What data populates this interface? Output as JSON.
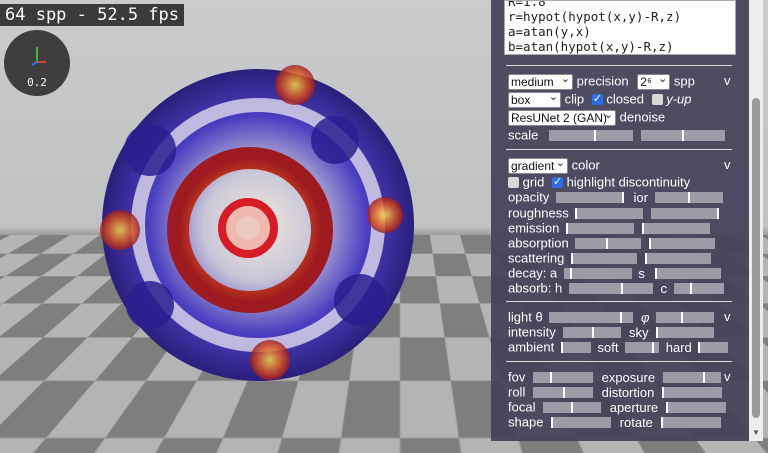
{
  "hud": {
    "fps_text": "64 spp - 52.5 fps",
    "gizmo_value": "0.2"
  },
  "code_lines": [
    "R=1.8",
    "r=hypot(hypot(x,y)-R,z)",
    "a=atan(y,x)",
    "b=atan(hypot(x,y)-R,z)"
  ],
  "render": {
    "precision_value": "medium",
    "precision_label": "precision",
    "spp_value": "2⁶",
    "spp_label": "spp",
    "collapse_label": "v",
    "clip_value": "box",
    "clip_label": "clip",
    "closed_label": "closed",
    "closed_checked": true,
    "yup_label": "y-up",
    "yup_checked": false,
    "denoise_value": "ResUNet 2 (GAN)",
    "denoise_label": "denoise",
    "scale_label": "scale",
    "scale_levels": [
      0.55,
      0.5
    ]
  },
  "color": {
    "mode_value": "gradient",
    "mode_label": "color",
    "collapse_label": "v",
    "grid_label": "grid",
    "grid_checked": false,
    "highlight_label": "highlight discontinuity",
    "highlight_checked": true,
    "opacity_label": "opacity",
    "opacity_level": 1.0,
    "ior_label": "ior",
    "ior_level": 0.5,
    "roughness_label": "roughness",
    "roughness_levels": [
      0.0,
      0.98
    ],
    "emission_label": "emission",
    "emission_levels": [
      0.0,
      0.0
    ],
    "absorption_label": "absorption",
    "absorption_levels": [
      0.48,
      0.0
    ],
    "scattering_label": "scattering",
    "scattering_levels": [
      0.0,
      0.0
    ],
    "decay_a_label": "decay: a",
    "decay_a_level": 0.1,
    "decay_s_label": "s",
    "decay_s_level": 0.0,
    "absorb_h_label": "absorb: h",
    "absorb_h_level": 0.63,
    "absorb_c_label": "c",
    "absorb_c_level": 0.35
  },
  "light": {
    "theta_label": "light θ",
    "theta_level": 0.85,
    "phi_label": "φ",
    "phi_level": 0.45,
    "collapse_label": "v",
    "intensity_label": "intensity",
    "intensity_level": 0.52,
    "sky_label": "sky",
    "sky_level": 0.0,
    "ambient_label": "ambient",
    "ambient_level": 0.0,
    "soft_label": "soft",
    "soft_level": 0.83,
    "hard_label": "hard",
    "hard_level": 0.0
  },
  "camera": {
    "fov_label": "fov",
    "fov_level": 0.3,
    "exposure_label": "exposure",
    "exposure_level": 0.72,
    "collapse_label": "v",
    "roll_label": "roll",
    "roll_level": 0.52,
    "distortion_label": "distortion",
    "distortion_level": 0.0,
    "focal_label": "focal",
    "focal_level": 0.5,
    "aperture_label": "aperture",
    "aperture_level": 0.0,
    "shape_label": "shape",
    "shape_level": 0.0,
    "rotate_label": "rotate",
    "rotate_level": 0.0
  },
  "colors": {
    "panel_bg": "#444058",
    "checkbox_on": "#2d6fe0",
    "slider_track": "#9e9aa8"
  }
}
